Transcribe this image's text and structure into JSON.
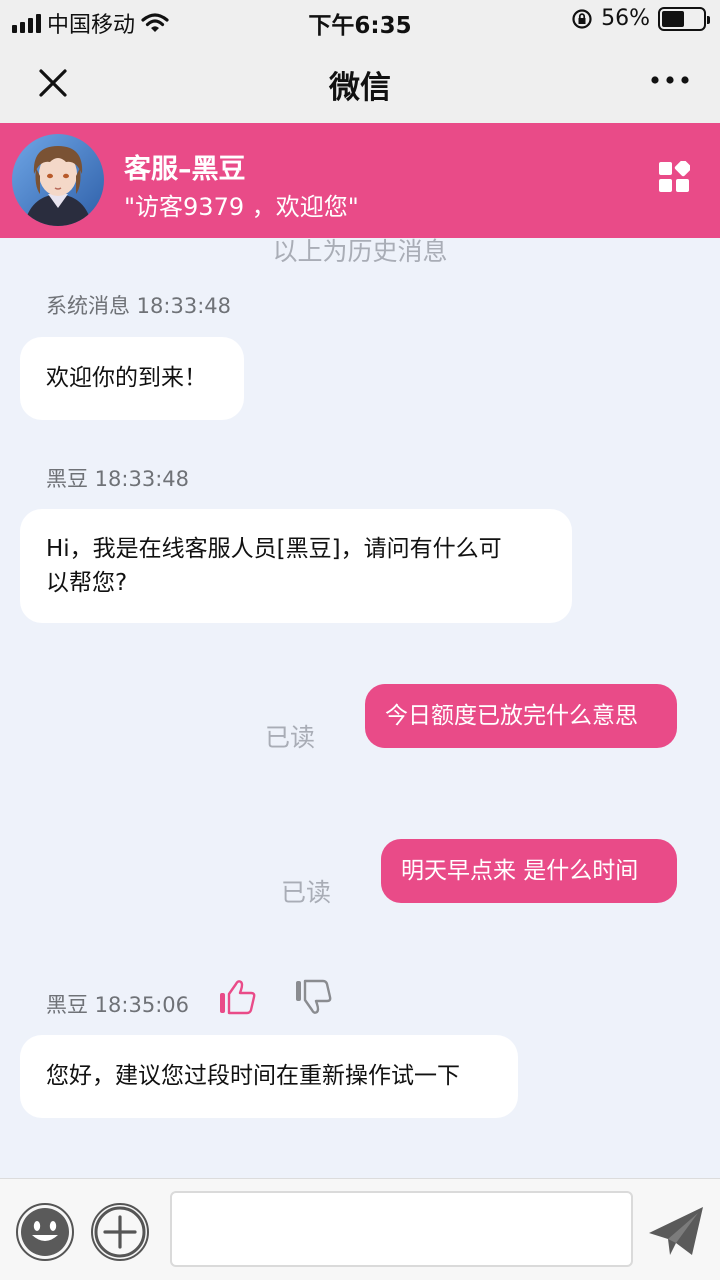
{
  "status_bar": {
    "carrier": "中国移动",
    "time": "下午6:35",
    "battery_percent": "56%",
    "battery_level": 0.56
  },
  "nav": {
    "title": "微信",
    "close_icon": "close-icon",
    "more_icon": "more-icon"
  },
  "agent": {
    "name": "客服–黑豆",
    "welcome": "\"访客9379 ，欢迎您\"",
    "grid_icon": "apps-icon"
  },
  "chat": {
    "history_note": "以上为历史消息",
    "messages": [
      {
        "sender": "系统消息",
        "time": "18:33:48",
        "meta": "系统消息 18:33:48",
        "text": "欢迎你的到来！",
        "direction": "in"
      },
      {
        "sender": "黑豆",
        "time": "18:33:48",
        "meta": "黑豆 18:33:48",
        "text_line1": "Hi，我是在线客服人员[黑豆]，请问有什么可",
        "text_line2": "以帮您?",
        "direction": "in"
      },
      {
        "text": "今日额度已放完什么意思",
        "status": "已读",
        "direction": "out"
      },
      {
        "text": "明天早点来 是什么时间",
        "status": "已读",
        "direction": "out"
      },
      {
        "sender": "黑豆",
        "time": "18:35:06",
        "meta": "黑豆 18:35:06",
        "text": "您好，建议您过段时间在重新操作试一下",
        "direction": "in",
        "thumbs_up_icon": "thumbs-up-icon",
        "thumbs_down_icon": "thumbs-down-icon"
      }
    ]
  },
  "input_bar": {
    "emoji_icon": "emoji-icon",
    "plus_icon": "plus-icon",
    "value": "",
    "placeholder": "",
    "send_icon": "send-icon"
  },
  "colors": {
    "accent": "#e94b88",
    "background": "#eef2fa",
    "bar": "#efefef"
  }
}
